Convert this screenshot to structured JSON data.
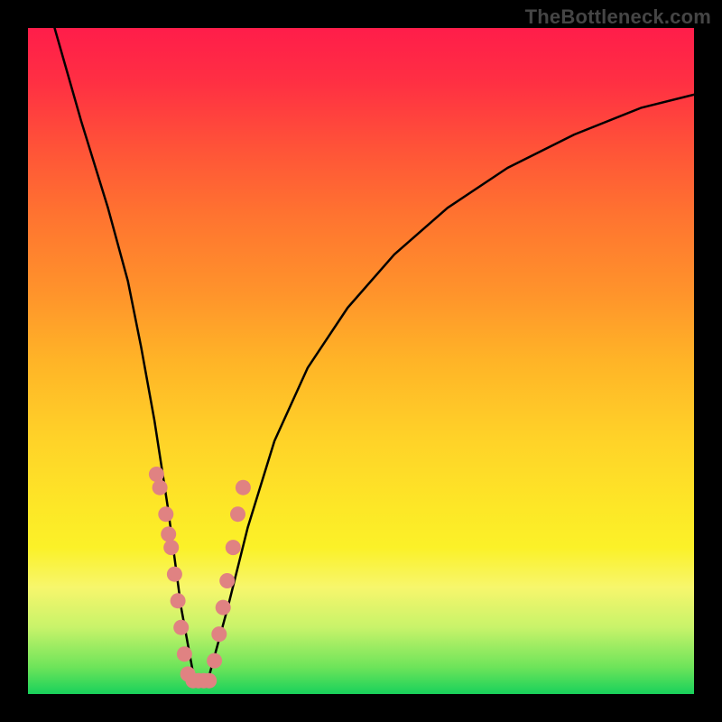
{
  "watermark": "TheBottleneck.com",
  "chart_data": {
    "type": "line",
    "title": "",
    "xlabel": "",
    "ylabel": "",
    "xlim": [
      0,
      100
    ],
    "ylim": [
      0,
      100
    ],
    "grid": false,
    "legend": false,
    "series": [
      {
        "name": "bottleneck-curve",
        "color": "#000000",
        "x": [
          4,
          8,
          12,
          15,
          17,
          19,
          21,
          23,
          25,
          27,
          30,
          33,
          37,
          42,
          48,
          55,
          63,
          72,
          82,
          92,
          100
        ],
        "y": [
          100,
          86,
          73,
          62,
          52,
          41,
          28,
          13,
          2,
          2,
          13,
          25,
          38,
          49,
          58,
          66,
          73,
          79,
          84,
          88,
          90
        ]
      },
      {
        "name": "sample-dots",
        "type": "scatter",
        "color": "#e08282",
        "x": [
          19.3,
          19.8,
          20.7,
          21.1,
          21.5,
          22.0,
          22.5,
          23.0,
          23.5,
          24.0,
          24.8,
          25.6,
          26.4,
          27.2,
          28.0,
          28.7,
          29.3,
          29.9,
          30.8,
          31.5,
          32.3
        ],
        "y": [
          33,
          31,
          27,
          24,
          22,
          18,
          14,
          10,
          6,
          3,
          2,
          2,
          2,
          2,
          5,
          9,
          13,
          17,
          22,
          27,
          31
        ]
      }
    ]
  }
}
